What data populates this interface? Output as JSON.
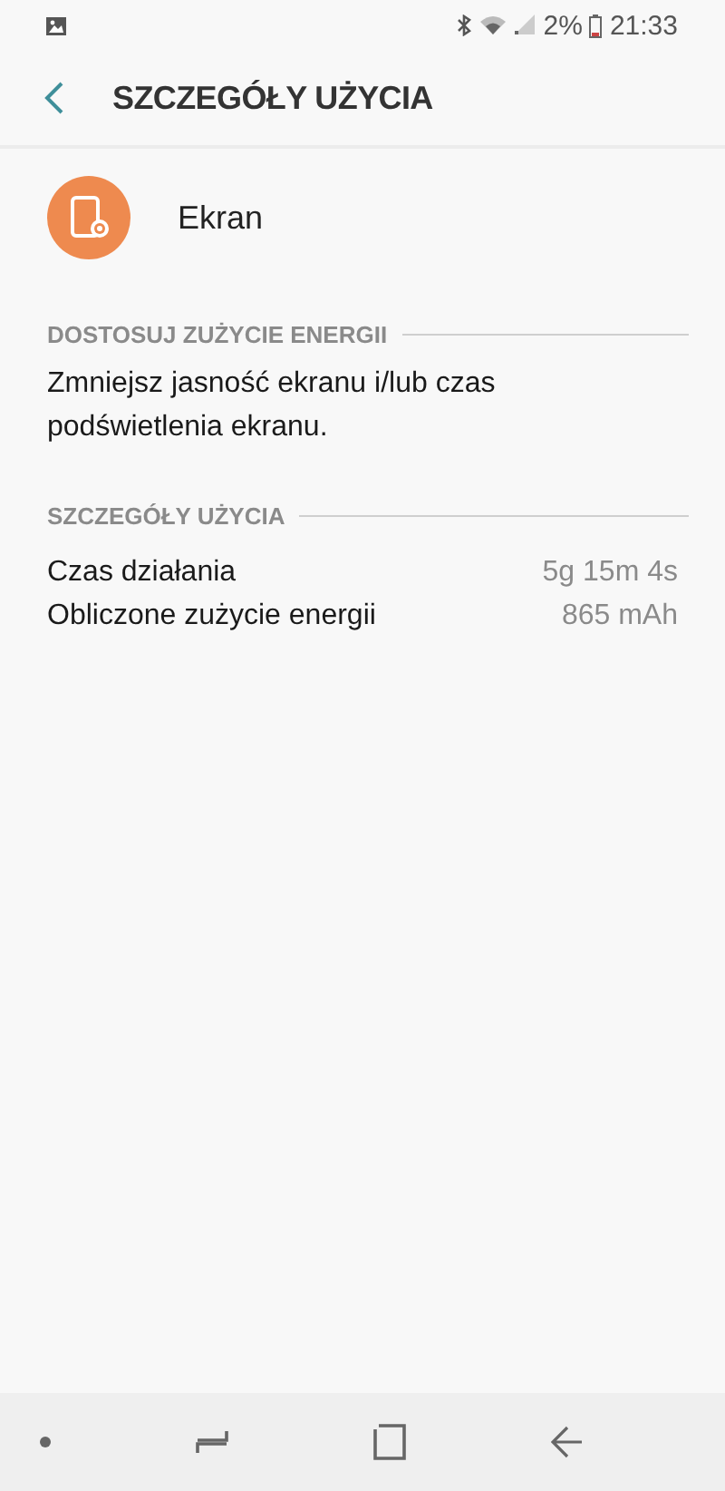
{
  "status_bar": {
    "battery_text": "2%",
    "time": "21:33"
  },
  "header": {
    "title": "SZCZEGÓŁY UŻYCIA"
  },
  "app": {
    "name": "Ekran"
  },
  "sections": [
    {
      "title": "DOSTOSUJ ZUŻYCIE ENERGII",
      "kind": "text",
      "text": "Zmniejsz jasność ekranu i/lub czas podświetlenia ekranu."
    },
    {
      "title": "SZCZEGÓŁY UŻYCIA",
      "kind": "rows",
      "rows": [
        {
          "label": "Czas działania",
          "value": "5g 15m 4s"
        },
        {
          "label": "Obliczone zużycie energii",
          "value": "865 mAh"
        }
      ]
    }
  ]
}
